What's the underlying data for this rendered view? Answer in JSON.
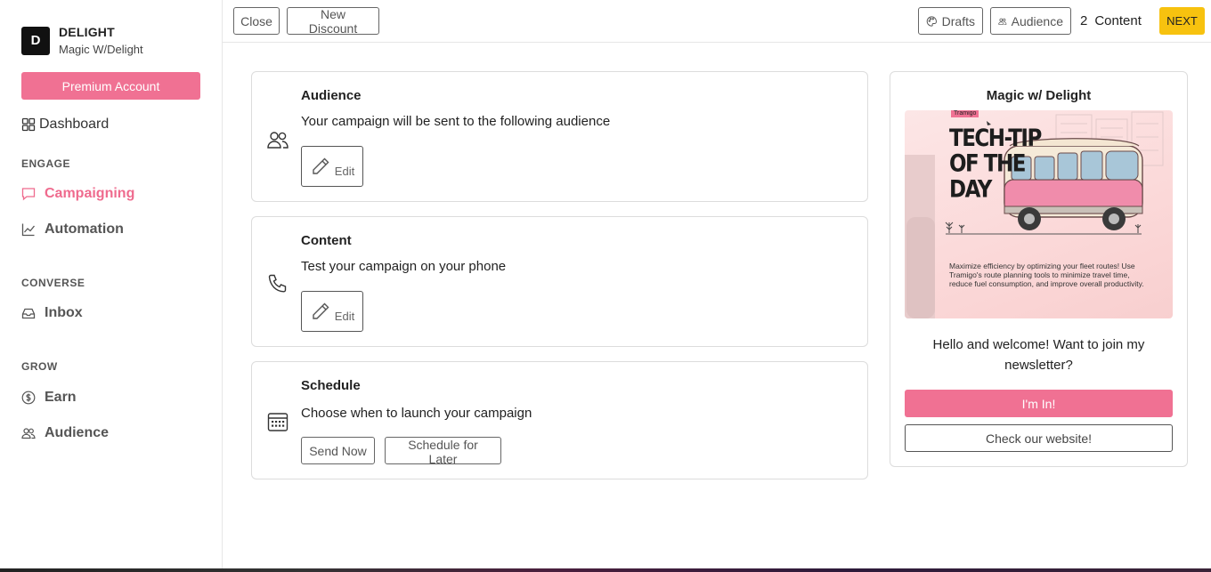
{
  "brand": {
    "initial": "D",
    "name": "DELIGHT",
    "subtitle": "Magic W/Delight"
  },
  "sidebar": {
    "premium_label": "Premium Account",
    "dashboard_label": "Dashboard",
    "sections": [
      {
        "title": "ENGAGE",
        "items": [
          {
            "label": "Campaigning",
            "icon": "message-icon",
            "active": true
          },
          {
            "label": "Automation",
            "icon": "chart-line-icon"
          }
        ]
      },
      {
        "title": "CONVERSE",
        "items": [
          {
            "label": "Inbox",
            "icon": "inbox-icon"
          }
        ]
      },
      {
        "title": "GROW",
        "items": [
          {
            "label": "Earn",
            "icon": "dollar-circle-icon"
          },
          {
            "label": "Audience",
            "icon": "people-icon"
          }
        ]
      }
    ]
  },
  "topbar": {
    "close_label": "Close",
    "new_discount_label": "New Discount",
    "drafts_label": "Drafts",
    "audience_label": "Audience",
    "step_number": "2",
    "step_label": "Content",
    "next_label": "NEXT"
  },
  "cards": {
    "audience": {
      "title": "Audience",
      "description": "Your campaign will be sent to the following audience",
      "edit_label": "Edit"
    },
    "content": {
      "title": "Content",
      "description": "Test your campaign on your phone",
      "edit_label": "Edit"
    },
    "schedule": {
      "title": "Schedule",
      "description": "Choose when to launch your campaign",
      "send_now_label": "Send Now",
      "schedule_later_label": "Schedule for Later"
    }
  },
  "preview": {
    "title": "Magic w/ Delight",
    "image": {
      "tag": "Tramigo",
      "headline_1": "TECH-TIP",
      "headline_2": "OF THE",
      "headline_3": "DAY",
      "body": "Maximize efficiency by optimizing your fleet routes! Use Tramigo's route planning tools to minimize travel time, reduce fuel consumption, and improve overall productivity."
    },
    "message": "Hello and welcome! Want to join my newsletter?",
    "primary_label": "I'm In!",
    "secondary_label": "Check our website!"
  },
  "colors": {
    "accent_pink": "#f07193",
    "next_yellow": "#f7c20f"
  }
}
